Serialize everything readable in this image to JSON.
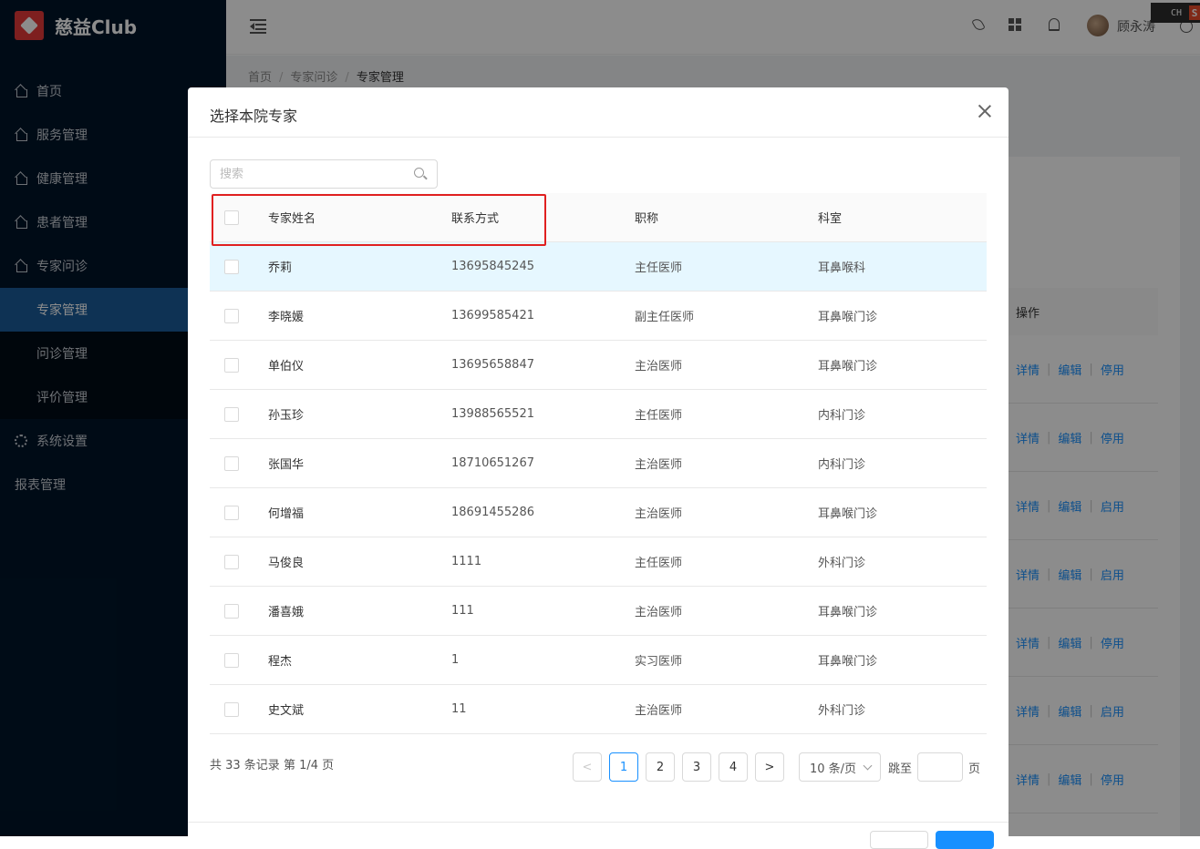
{
  "app": {
    "logo_text": "慈益Club"
  },
  "sidebar": {
    "items": [
      {
        "label": "首页",
        "icon": "home-icon"
      },
      {
        "label": "服务管理",
        "icon": "home-icon"
      },
      {
        "label": "健康管理",
        "icon": "home-icon"
      },
      {
        "label": "患者管理",
        "icon": "home-icon"
      },
      {
        "label": "专家问诊",
        "icon": "home-icon"
      },
      {
        "label": "专家管理",
        "sub": true,
        "active": true
      },
      {
        "label": "问诊管理",
        "sub": true
      },
      {
        "label": "评价管理",
        "sub": true
      },
      {
        "label": "系统设置",
        "icon": "gear-icon"
      },
      {
        "label": "报表管理"
      }
    ]
  },
  "header": {
    "user_name": "顾永涛",
    "ime": "CH",
    "ime_badge": "S"
  },
  "breadcrumb": [
    "首页",
    "专家问诊",
    "专家管理"
  ],
  "background_table": {
    "header": "操作",
    "rows": [
      [
        "详情",
        "编辑",
        "停用"
      ],
      [
        "详情",
        "编辑",
        "停用"
      ],
      [
        "详情",
        "编辑",
        "启用"
      ],
      [
        "详情",
        "编辑",
        "启用"
      ],
      [
        "详情",
        "编辑",
        "停用"
      ],
      [
        "详情",
        "编辑",
        "启用"
      ],
      [
        "详情",
        "编辑",
        "停用"
      ]
    ]
  },
  "modal": {
    "title": "选择本院专家",
    "search_placeholder": "搜索",
    "columns": [
      "专家姓名",
      "联系方式",
      "职称",
      "科室"
    ],
    "rows": [
      {
        "name": "乔莉",
        "phone": "13695845245",
        "title": "主任医师",
        "dept": "耳鼻喉科"
      },
      {
        "name": "李晓媛",
        "phone": "13699585421",
        "title": "副主任医师",
        "dept": "耳鼻喉门诊"
      },
      {
        "name": "单伯仪",
        "phone": "13695658847",
        "title": "主治医师",
        "dept": "耳鼻喉门诊"
      },
      {
        "name": "孙玉珍",
        "phone": "13988565521",
        "title": "主任医师",
        "dept": "内科门诊"
      },
      {
        "name": "张国华",
        "phone": "18710651267",
        "title": "主治医师",
        "dept": "内科门诊"
      },
      {
        "name": "何增福",
        "phone": "18691455286",
        "title": "主治医师",
        "dept": "耳鼻喉门诊"
      },
      {
        "name": "马俊良",
        "phone": "1111",
        "title": "主任医师",
        "dept": "外科门诊"
      },
      {
        "name": "潘喜娥",
        "phone": "111",
        "title": "主治医师",
        "dept": "耳鼻喉门诊"
      },
      {
        "name": "程杰",
        "phone": "1",
        "title": "实习医师",
        "dept": "耳鼻喉门诊"
      },
      {
        "name": "史文斌",
        "phone": "11",
        "title": "主治医师",
        "dept": "外科门诊"
      }
    ],
    "total_text": "共 33 条记录 第 1/4 页",
    "pages": [
      "1",
      "2",
      "3",
      "4"
    ],
    "current_page": "1",
    "page_size": "10 条/页",
    "jump_label": "跳至",
    "page_unit": "页"
  }
}
